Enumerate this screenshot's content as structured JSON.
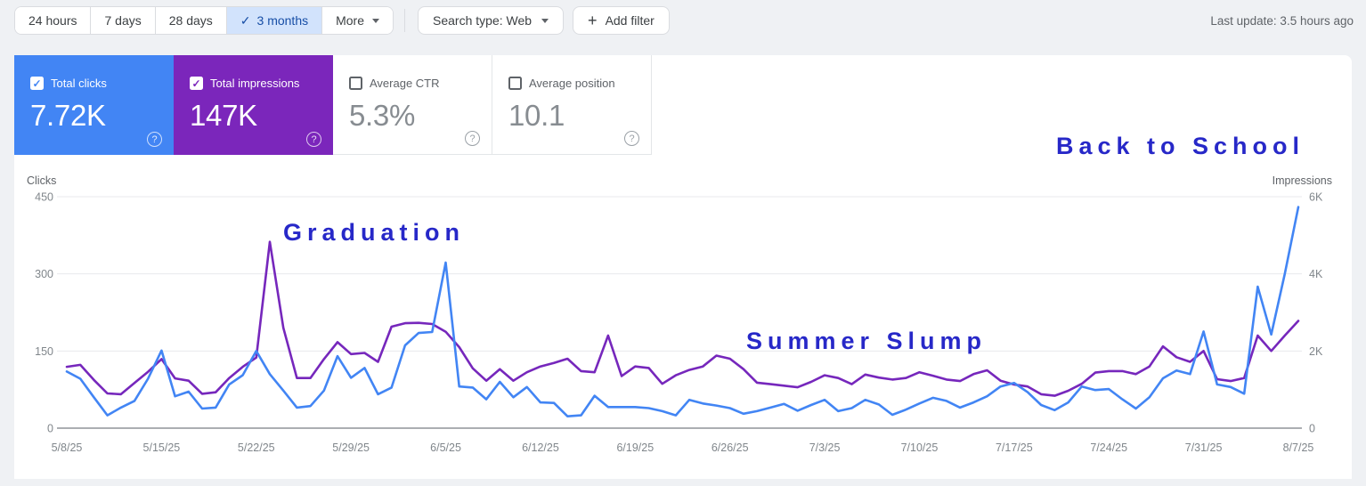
{
  "toolbar": {
    "date_ranges": [
      {
        "label": "24 hours",
        "selected": false
      },
      {
        "label": "7 days",
        "selected": false
      },
      {
        "label": "28 days",
        "selected": false
      },
      {
        "label": "3 months",
        "selected": true
      }
    ],
    "check_glyph": "✓",
    "more_label": "More",
    "search_type_label": "Search type: Web",
    "add_filter_label": "Add filter",
    "plus_glyph": "+",
    "last_update": "Last update: 3.5 hours ago"
  },
  "metric_cards": [
    {
      "label": "Total clicks",
      "value": "7.72K",
      "checked": true,
      "color": "#4285f4",
      "help_icon": "help-circle-icon",
      "check_glyph": "✓"
    },
    {
      "label": "Total impressions",
      "value": "147K",
      "checked": true,
      "color": "#7b26bb",
      "help_icon": "help-circle-icon",
      "check_glyph": "✓"
    },
    {
      "label": "Average CTR",
      "value": "5.3%",
      "checked": false,
      "help_icon": "help-circle-icon"
    },
    {
      "label": "Average position",
      "value": "10.1",
      "checked": false,
      "help_icon": "help-circle-icon"
    }
  ],
  "annotations": [
    {
      "text": "Graduation",
      "color": "#2728c8"
    },
    {
      "text": "Summer Slump",
      "color": "#2728c8"
    },
    {
      "text": "Back to School",
      "color": "#2728c8"
    }
  ],
  "chart_data": {
    "type": "line",
    "grid": true,
    "left_axis": {
      "label": "Clicks",
      "max": 450,
      "ticks": [
        {
          "label": "450",
          "value": 450
        },
        {
          "label": "300",
          "value": 300
        },
        {
          "label": "150",
          "value": 150
        },
        {
          "label": "0",
          "value": 0
        }
      ]
    },
    "right_axis": {
      "label": "Impressions",
      "max": 6000,
      "ticks": [
        {
          "label": "6K",
          "value": 6000
        },
        {
          "label": "4K",
          "value": 4000
        },
        {
          "label": "2K",
          "value": 2000
        },
        {
          "label": "0",
          "value": 0
        }
      ]
    },
    "x_tick_labels": [
      "5/8/25",
      "5/15/25",
      "5/22/25",
      "5/29/25",
      "6/5/25",
      "6/12/25",
      "6/19/25",
      "6/26/25",
      "7/3/25",
      "7/10/25",
      "7/17/25",
      "7/24/25",
      "7/31/25",
      "8/7/25"
    ],
    "dates": [
      "5/8/25",
      "5/9/25",
      "5/10/25",
      "5/11/25",
      "5/12/25",
      "5/13/25",
      "5/14/25",
      "5/15/25",
      "5/16/25",
      "5/17/25",
      "5/18/25",
      "5/19/25",
      "5/20/25",
      "5/21/25",
      "5/22/25",
      "5/23/25",
      "5/24/25",
      "5/25/25",
      "5/26/25",
      "5/27/25",
      "5/28/25",
      "5/29/25",
      "5/30/25",
      "5/31/25",
      "6/1/25",
      "6/2/25",
      "6/3/25",
      "6/4/25",
      "6/5/25",
      "6/6/25",
      "6/7/25",
      "6/8/25",
      "6/9/25",
      "6/10/25",
      "6/11/25",
      "6/12/25",
      "6/13/25",
      "6/14/25",
      "6/15/25",
      "6/16/25",
      "6/17/25",
      "6/18/25",
      "6/19/25",
      "6/20/25",
      "6/21/25",
      "6/22/25",
      "6/23/25",
      "6/24/25",
      "6/25/25",
      "6/26/25",
      "6/27/25",
      "6/28/25",
      "6/29/25",
      "6/30/25",
      "7/1/25",
      "7/2/25",
      "7/3/25",
      "7/4/25",
      "7/5/25",
      "7/6/25",
      "7/7/25",
      "7/8/25",
      "7/9/25",
      "7/10/25",
      "7/11/25",
      "7/12/25",
      "7/13/25",
      "7/14/25",
      "7/15/25",
      "7/16/25",
      "7/17/25",
      "7/18/25",
      "7/19/25",
      "7/20/25",
      "7/21/25",
      "7/22/25",
      "7/23/25",
      "7/24/25",
      "7/25/25",
      "7/26/25",
      "7/27/25",
      "7/28/25",
      "7/29/25",
      "7/30/25",
      "7/31/25",
      "8/1/25",
      "8/2/25",
      "8/3/25",
      "8/4/25",
      "8/5/25",
      "8/6/25",
      "8/7/25"
    ],
    "series": [
      {
        "name": "Total clicks",
        "axis": "left",
        "color": "#4285f4",
        "values": [
          110,
          96,
          60,
          25,
          40,
          53,
          96,
          151,
          62,
          71,
          38,
          40,
          85,
          103,
          150,
          105,
          73,
          40,
          43,
          73,
          140,
          98,
          117,
          66,
          79,
          161,
          185,
          187,
          322,
          81,
          79,
          56,
          90,
          60,
          80,
          50,
          49,
          23,
          25,
          63,
          41,
          41,
          41,
          39,
          33,
          25,
          55,
          48,
          44,
          39,
          28,
          33,
          40,
          47,
          34,
          45,
          55,
          33,
          39,
          55,
          46,
          26,
          36,
          48,
          59,
          53,
          40,
          50,
          62,
          81,
          88,
          70,
          45,
          35,
          50,
          81,
          74,
          76,
          56,
          38,
          60,
          97,
          112,
          105,
          188,
          85,
          80,
          67,
          275,
          182,
          300,
          430
        ]
      },
      {
        "name": "Total impressions",
        "axis": "right",
        "color": "#7627bc",
        "values": [
          1590,
          1640,
          1250,
          900,
          880,
          1170,
          1460,
          1790,
          1290,
          1230,
          890,
          930,
          1300,
          1590,
          1830,
          4830,
          2600,
          1300,
          1300,
          1790,
          2230,
          1920,
          1950,
          1720,
          2630,
          2720,
          2730,
          2700,
          2500,
          2100,
          1550,
          1230,
          1530,
          1230,
          1450,
          1600,
          1690,
          1800,
          1480,
          1450,
          2400,
          1350,
          1600,
          1560,
          1150,
          1370,
          1510,
          1600,
          1880,
          1800,
          1530,
          1180,
          1140,
          1100,
          1060,
          1200,
          1370,
          1300,
          1140,
          1390,
          1310,
          1260,
          1300,
          1450,
          1360,
          1260,
          1220,
          1400,
          1500,
          1230,
          1130,
          1080,
          880,
          840,
          970,
          1150,
          1440,
          1480,
          1480,
          1400,
          1600,
          2120,
          1840,
          1720,
          2000,
          1270,
          1220,
          1300,
          2400,
          2000,
          2400,
          2780
        ]
      }
    ]
  }
}
